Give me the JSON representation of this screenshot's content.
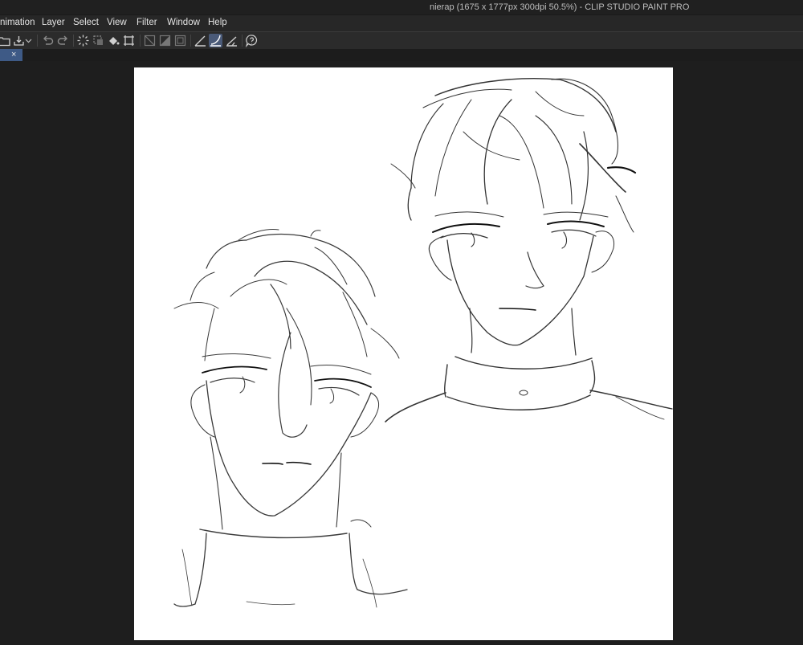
{
  "window": {
    "title": "nierap (1675 x 1777px 300dpi 50.5%)  - CLIP STUDIO PAINT PRO"
  },
  "menu": {
    "items": [
      "nimation",
      "Layer",
      "Select",
      "View",
      "Filter",
      "Window",
      "Help"
    ]
  },
  "tabs": {
    "close_glyph": "×"
  },
  "colors": {
    "accent": "#3e5a86",
    "active_tool": "#4a5a78",
    "background": "#1e1e1e",
    "canvas": "#ffffff"
  },
  "toolbar": {
    "icons": [
      "open-icon",
      "save-icon",
      "dropdown-icon",
      "undo-icon",
      "redo-icon",
      "clear-icon",
      "selection-icon",
      "fill-icon",
      "transform-icon",
      "hide-selection-icon",
      "fill-selection-icon",
      "border-icon",
      "ruler-icon",
      "snap-curve-icon",
      "snap-grid-icon",
      "help-icon"
    ]
  }
}
